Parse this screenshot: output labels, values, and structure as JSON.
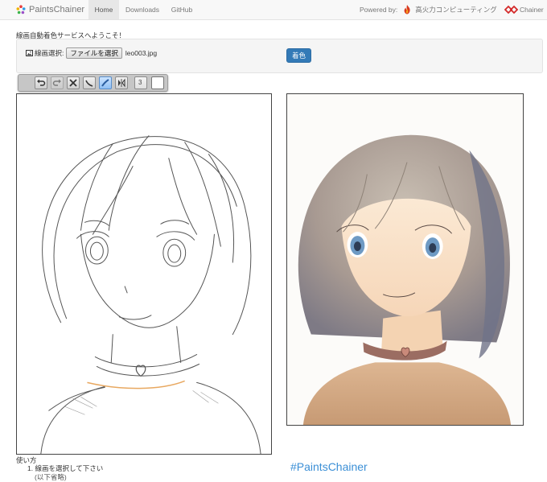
{
  "navbar": {
    "brand": "PaintsChainer",
    "tabs": [
      {
        "label": "Home",
        "active": true
      },
      {
        "label": "Downloads",
        "active": false
      },
      {
        "label": "GitHub",
        "active": false
      }
    ],
    "powered_by_label": "Powered by:",
    "powered_by_name": "高火力コンピューティング",
    "chainer_link": "Chainer"
  },
  "main": {
    "welcome": "線画自動着色サービスへようこそ！",
    "file_label": "線画選択:",
    "file_button": "ファイルを選択",
    "file_name": "leo003.jpg",
    "colorize_button": "着色"
  },
  "toolbar": {
    "tools": [
      "undo-icon",
      "redo-icon",
      "clear-icon",
      "pencil-icon",
      "brush-icon",
      "mirror-icon",
      "size-icon",
      "color-swatch"
    ],
    "brush_size": "3",
    "selected_color": "#ffffff"
  },
  "footer": {
    "howto_title": "使い方",
    "step1": "1. 線画を選択して下さい",
    "step1_note": "(以下省略)",
    "hashtag": "#PaintsChainer"
  },
  "colors": {
    "accent": "#337ab7",
    "hashtag": "#3b8fd6"
  }
}
